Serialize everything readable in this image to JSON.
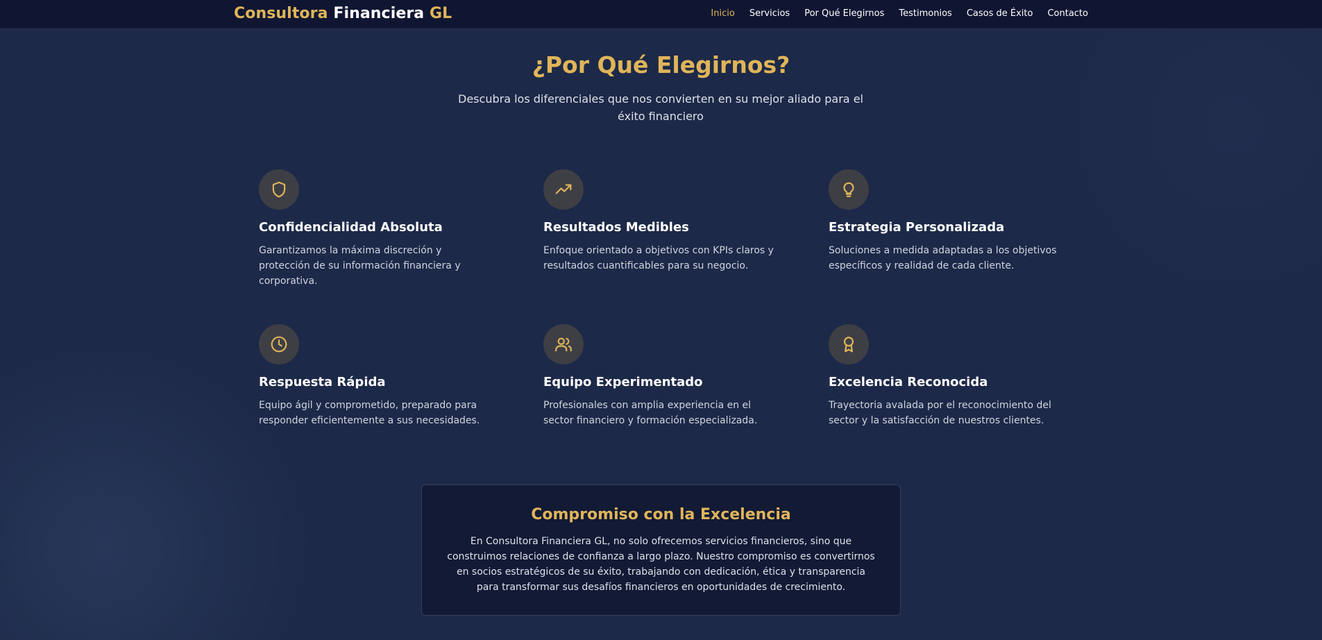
{
  "brand": {
    "part1": "Consultora",
    "part2": "Financiera",
    "part3": "GL"
  },
  "nav": [
    {
      "label": "Inicio",
      "active": true
    },
    {
      "label": "Servicios"
    },
    {
      "label": "Por Qué Elegirnos"
    },
    {
      "label": "Testimonios"
    },
    {
      "label": "Casos de Éxito"
    },
    {
      "label": "Contacto"
    }
  ],
  "section": {
    "title": "¿Por Qué Elegirnos?",
    "subtitle": "Descubra los diferenciales que nos convierten en su mejor aliado para el éxito financiero"
  },
  "features": [
    {
      "icon": "shield-icon",
      "title": "Confidencialidad Absoluta",
      "text": "Garantizamos la máxima discreción y protección de su información financiera y corporativa."
    },
    {
      "icon": "trending-up-icon",
      "title": "Resultados Medibles",
      "text": "Enfoque orientado a objetivos con KPIs claros y resultados cuantificables para su negocio."
    },
    {
      "icon": "lightbulb-icon",
      "title": "Estrategia Personalizada",
      "text": "Soluciones a medida adaptadas a los objetivos específicos y realidad de cada cliente."
    },
    {
      "icon": "clock-icon",
      "title": "Respuesta Rápida",
      "text": "Equipo ágil y comprometido, preparado para responder eficientemente a sus necesidades."
    },
    {
      "icon": "users-icon",
      "title": "Equipo Experimentado",
      "text": "Profesionales con amplia experiencia en el sector financiero y formación especializada."
    },
    {
      "icon": "award-icon",
      "title": "Excelencia Reconocida",
      "text": "Trayectoria avalada por el reconocimiento del sector y la satisfacción de nuestros clientes."
    }
  ],
  "commitment": {
    "title": "Compromiso con la Excelencia",
    "text": "En Consultora Financiera GL, no solo ofrecemos servicios financieros, sino que construimos relaciones de confianza a largo plazo. Nuestro compromiso es convertirnos en socios estratégicos de su éxito, trabajando con dedicación, ética y transparencia para transformar sus desafíos financieros en oportunidades de crecimiento."
  },
  "colors": {
    "accent": "#e0b559",
    "background": "#1d2948",
    "navbar": "#101632"
  }
}
